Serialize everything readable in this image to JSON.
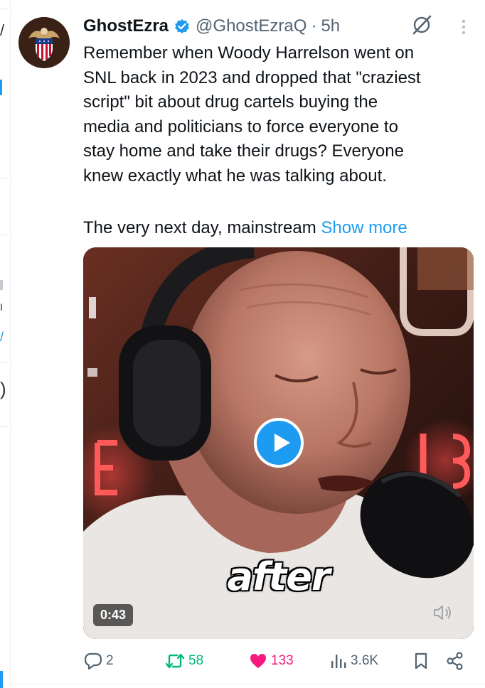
{
  "tweet": {
    "display_name": "GhostEzra",
    "handle": "@GhostEzraQ",
    "separator": "·",
    "time": "5h",
    "text_paragraph_1": "Remember when Woody Harrelson went on\nSNL back in 2023 and dropped that \"craziest\nscript\" bit about drug cartels buying the\nmedia and politicians to force everyone to\nstay home and take their drugs? Everyone\nknew exactly what he was talking about.",
    "text_paragraph_2": "The very next day, mainstream ",
    "show_more_label": "Show more"
  },
  "video": {
    "caption": "after",
    "duration": "0:43"
  },
  "actions": {
    "replies": "2",
    "reposts": "58",
    "likes": "133",
    "views": "3.6K"
  },
  "icons": {
    "verified": "verified-badge-icon",
    "grok": "grok-icon",
    "more": "more-vertical-icon",
    "play": "play-icon",
    "mute": "volume-muted-icon",
    "reply": "reply-icon",
    "repost": "repost-icon",
    "like": "heart-icon",
    "views": "views-icon",
    "bookmark": "bookmark-icon",
    "share": "share-icon"
  },
  "colors": {
    "accent": "#1d9bf0",
    "repost": "#00ba7c",
    "like": "#f91880",
    "secondary_text": "#536471"
  }
}
